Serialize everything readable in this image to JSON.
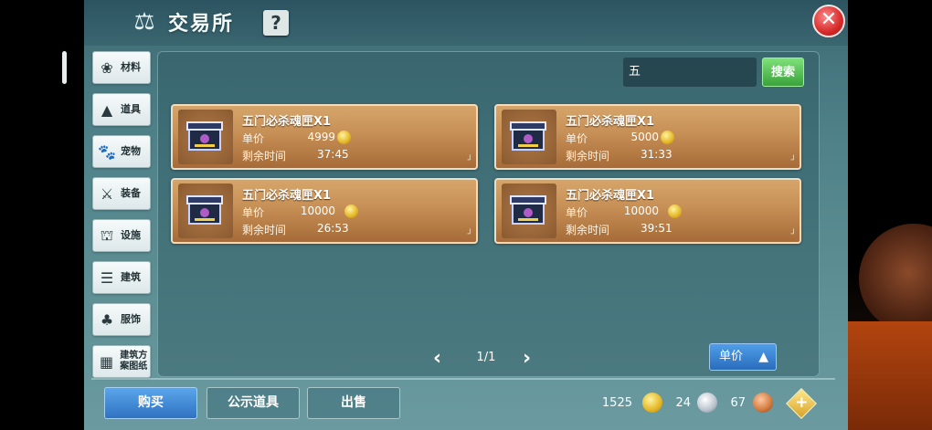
{
  "window": {
    "title": "交易所",
    "help": "?",
    "close": "✕"
  },
  "sidebar": {
    "items": [
      {
        "label": "材料",
        "icon": "material-icon"
      },
      {
        "label": "道具",
        "icon": "item-icon"
      },
      {
        "label": "宠物",
        "icon": "pet-icon"
      },
      {
        "label": "装备",
        "icon": "equipment-icon"
      },
      {
        "label": "设施",
        "icon": "facility-icon"
      },
      {
        "label": "建筑",
        "icon": "building-icon"
      },
      {
        "label": "服饰",
        "icon": "clothing-icon"
      },
      {
        "label": "建筑方案图纸",
        "icon": "blueprint-icon"
      }
    ]
  },
  "search": {
    "value": "五",
    "button": "搜索"
  },
  "listings": [
    {
      "name": "五门必杀魂匣X1",
      "price_label": "单价",
      "price": "4999",
      "time_label": "剩余时间",
      "time": "37:45"
    },
    {
      "name": "五门必杀魂匣X1",
      "price_label": "单价",
      "price": "5000",
      "time_label": "剩余时间",
      "time": "31:33"
    },
    {
      "name": "五门必杀魂匣X1",
      "price_label": "单价",
      "price": "10000",
      "time_label": "剩余时间",
      "time": "26:53"
    },
    {
      "name": "五门必杀魂匣X1",
      "price_label": "单价",
      "price": "10000",
      "time_label": "剩余时间",
      "time": "39:51"
    }
  ],
  "pager": {
    "text": "1/1"
  },
  "sort": {
    "label": "单价"
  },
  "tabs": {
    "buy": "购买",
    "public": "公示道具",
    "sell": "出售"
  },
  "currency": {
    "gold": "1525",
    "silver": "24",
    "copper": "67"
  },
  "colors": {
    "panel": "#4e8088",
    "card": "#c68f55",
    "buy_tab": "#2f72c2",
    "search_button": "#3aa33a"
  }
}
